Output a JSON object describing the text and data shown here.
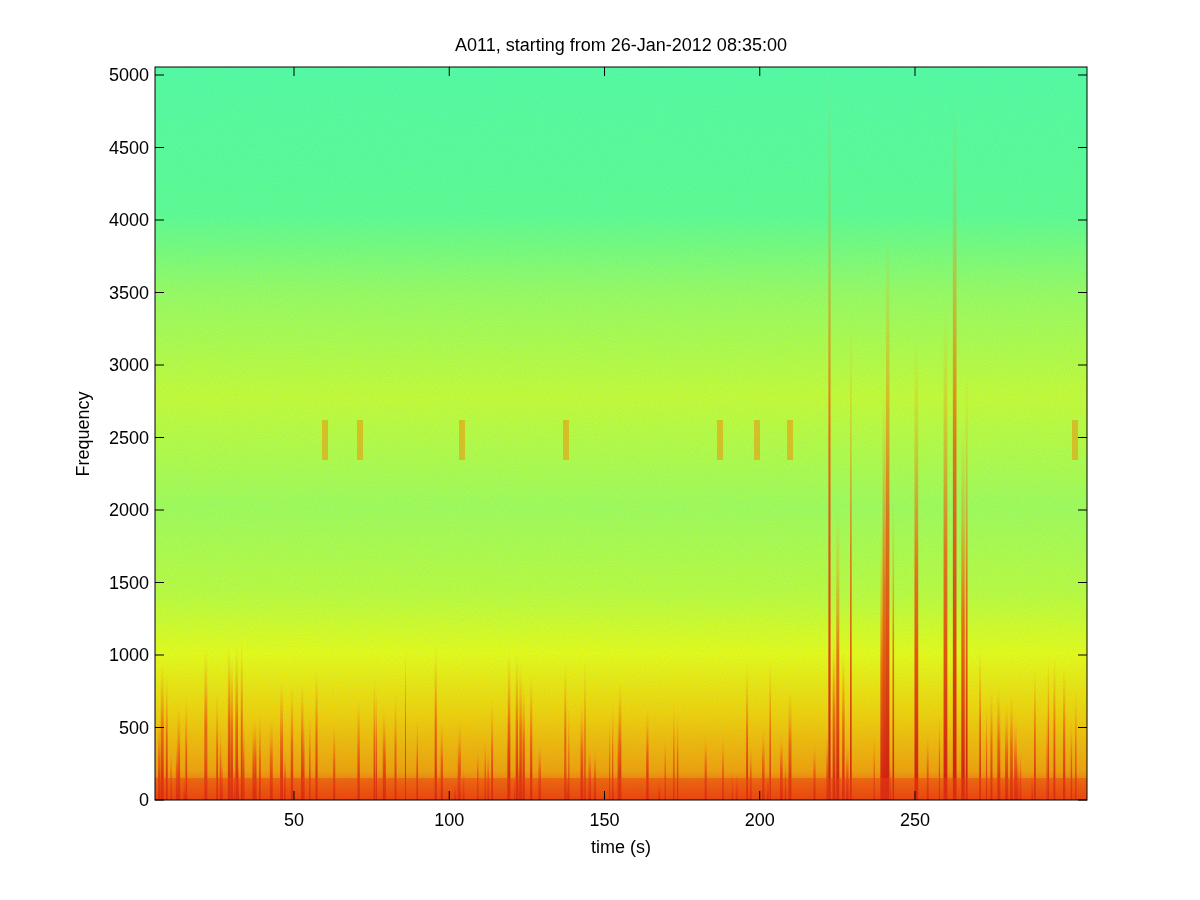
{
  "figure": {
    "title": "A011, starting from 26-Jan-2012 08:35:00",
    "xlabel": "time (s)",
    "ylabel": "Frequency",
    "xticks": [
      "50",
      "100",
      "150",
      "200",
      "250"
    ],
    "yticks": [
      "5000",
      "4500",
      "4000",
      "3500",
      "3000",
      "2500",
      "2000",
      "1500",
      "1000",
      "500",
      "0"
    ]
  }
}
